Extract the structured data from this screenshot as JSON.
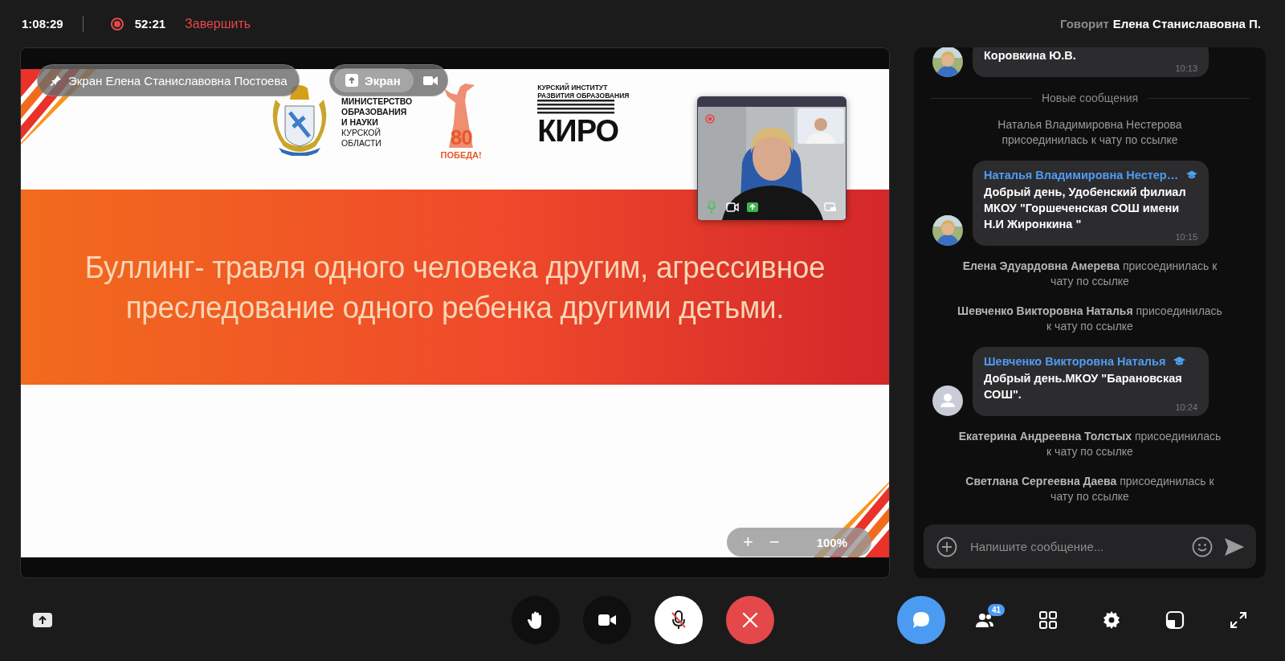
{
  "top_bar": {
    "elapsed": "1:08:29",
    "recording": {
      "on": true,
      "time": "52:21"
    },
    "end_recording": "Завершить",
    "speaker_label": "Говорит",
    "speaker_name": "Елена Станиславовна П."
  },
  "screen_share": {
    "pinned_label": "Экран Елена Станиславовна Постоева",
    "source_button": "Экран",
    "slide": {
      "ministry_bold": [
        "МИНИСТЕРСТВО",
        "ОБРАЗОВАНИЯ",
        "И НАУКИ"
      ],
      "ministry_region": [
        "КУРСКОЙ",
        "ОБЛАСТИ"
      ],
      "anniversary_number": "80",
      "anniversary_caption": "ПОБЕДА!",
      "institute": [
        "КУРСКИЙ ИНСТИТУТ",
        "РАЗВИТИЯ ОБРАЗОВАНИЯ"
      ],
      "institute_logo": "КИРО",
      "title": "Буллинг- травля одного человека другим, агрессивное преследование одного ребенка другими детьми."
    },
    "zoom": {
      "zoom_in": "+",
      "zoom_out": "−",
      "value": "100%"
    }
  },
  "chat": {
    "items": [
      {
        "kind": "message",
        "text": "Коровкина Ю.В.",
        "time": "10:13"
      },
      {
        "kind": "divider",
        "text": "Новые сообщения"
      },
      {
        "kind": "system",
        "text": "Наталья Владимировна Нестерова присоединилась к чату по ссылке"
      },
      {
        "kind": "message",
        "sender": "Наталья Владимировна Нестер…",
        "verified": true,
        "text": "Добрый день, Удобенский филиал МКОУ \"Горшеченская СОШ имени Н.И Жиронкина \"",
        "time": "10:15"
      },
      {
        "kind": "system",
        "name": "Елена Эдуардовна Амерева",
        "text": "присоединилась к чату по ссылке"
      },
      {
        "kind": "system",
        "name": "Шевченко Викторовна Наталья",
        "text": "присоединилась к чату по ссылке"
      },
      {
        "kind": "message",
        "sender": "Шевченко Викторовна Наталья",
        "verified": true,
        "text": "Добрый день.МКОУ \"Барановская СОШ\".",
        "time": "10:24",
        "avatar": {
          "kind": "placeholder"
        }
      },
      {
        "kind": "system",
        "name": "Екатерина Андреевна Толстых",
        "text": "присоединилась к чату по ссылке"
      },
      {
        "kind": "system",
        "name": "Светлана Сергеевна Даева",
        "text": "присоединилась к чату по ссылке"
      }
    ],
    "composer": {
      "placeholder": "Напишите сообщение..."
    }
  },
  "center_controls": [
    {
      "kind": "hand"
    },
    {
      "kind": "camera"
    },
    {
      "kind": "microphone",
      "muted": true
    },
    {
      "kind": "hang-up"
    }
  ],
  "side_controls": [
    {
      "kind": "chat",
      "selected": true
    },
    {
      "kind": "participants",
      "selected": false,
      "badge": "41"
    },
    {
      "kind": "grid",
      "selected": false
    },
    {
      "kind": "settings",
      "selected": false
    },
    {
      "kind": "layout",
      "selected": false
    },
    {
      "kind": "fullscreen",
      "selected": false
    }
  ]
}
